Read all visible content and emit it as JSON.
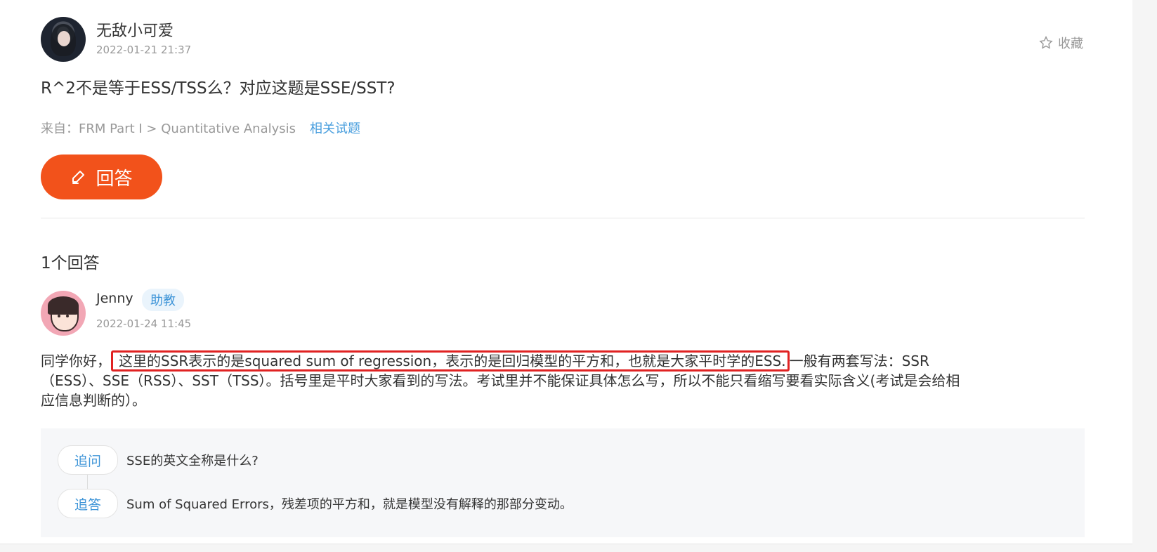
{
  "question": {
    "username": "无敌小可爱",
    "time": "2022-01-21 21:37",
    "favorite_label": "收藏",
    "title": "R^2不是等于ESS/TSS么？对应这题是SSE/SST?",
    "source_text": "来自：FRM Part I > Quantitative Analysis",
    "related_link": "相关试题",
    "answer_button_label": "回答"
  },
  "answers": {
    "count_label": "1个回答",
    "items": [
      {
        "username": "Jenny",
        "badge": "助教",
        "time": "2022-01-24 11:45",
        "body_prefix": "同学你好，",
        "body_highlight": "这里的SSR表示的是squared sum of regression，表示的是回归模型的平方和，也就是大家平时学的ESS.",
        "body_suffix": "一般有两套写法：SSR（ESS）、SSE（RSS）、SST（TSS）。括号里是平时大家看到的写法。考试里并不能保证具体怎么写，所以不能只看缩写要看实际含义(考试是会给相应信息判断的）。",
        "followups": [
          {
            "tag": "追问",
            "text": "SSE的英文全称是什么?"
          },
          {
            "tag": "追答",
            "text": "Sum of Squared Errors，残差项的平方和，就是模型没有解释的那部分变动。"
          }
        ]
      }
    ]
  },
  "colors": {
    "accent": "#f2521b",
    "link": "#4a9fde",
    "highlight_border": "#e02222",
    "muted": "#999999"
  },
  "icons": {
    "favorite": "star-outline-icon",
    "answer": "pencil-icon"
  }
}
